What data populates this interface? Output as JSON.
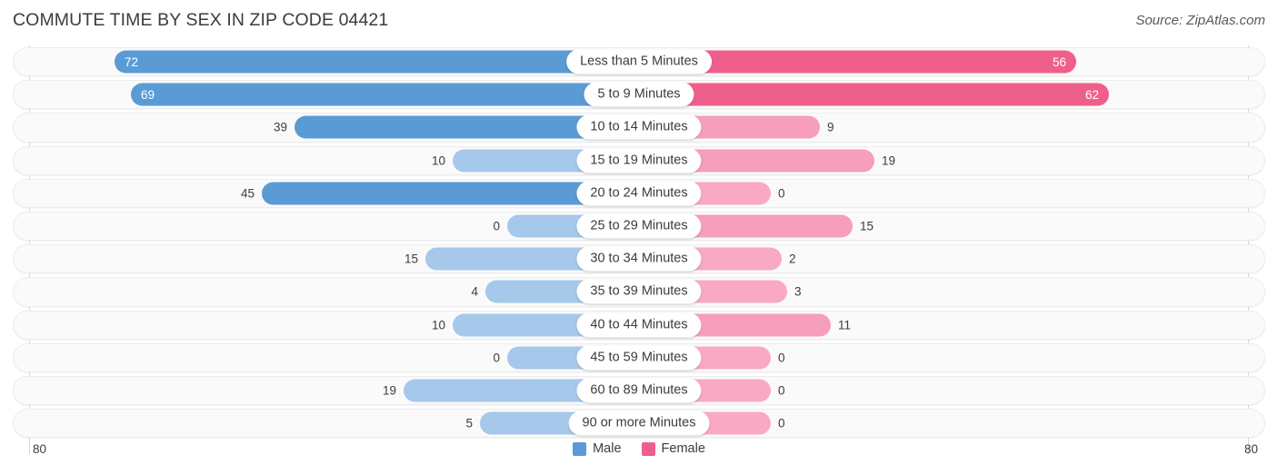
{
  "header": {
    "title": "COMMUTE TIME BY SEX IN ZIP CODE 04421",
    "source": "Source: ZipAtlas.com"
  },
  "footer": {
    "axis_left": "80",
    "axis_right": "80"
  },
  "legend": {
    "items": [
      {
        "label": "Male",
        "color": "#5b9bd5",
        "icon": "legend-swatch"
      },
      {
        "label": "Female",
        "color": "#ef5f8c",
        "icon": "legend-swatch"
      }
    ]
  },
  "chart_data": {
    "type": "bar",
    "subtype": "diverging-bidirectional",
    "title": "COMMUTE TIME BY SEX IN ZIP CODE 04421",
    "xlabel": "",
    "ylabel": "",
    "axis_max": 80,
    "axis_left_tick": "80",
    "axis_right_tick": "80",
    "grid": false,
    "legend_position": "bottom-center",
    "categories": [
      "Less than 5 Minutes",
      "5 to 9 Minutes",
      "10 to 14 Minutes",
      "15 to 19 Minutes",
      "20 to 24 Minutes",
      "25 to 29 Minutes",
      "30 to 34 Minutes",
      "35 to 39 Minutes",
      "40 to 44 Minutes",
      "45 to 59 Minutes",
      "60 to 89 Minutes",
      "90 or more Minutes"
    ],
    "series": [
      {
        "name": "Male",
        "color": "#5b9bd5",
        "direction": "left",
        "values": [
          72,
          69,
          39,
          10,
          45,
          0,
          15,
          4,
          10,
          0,
          19,
          5
        ]
      },
      {
        "name": "Female",
        "color": "#ef5f8c",
        "direction": "right",
        "values": [
          56,
          62,
          9,
          19,
          0,
          15,
          2,
          3,
          11,
          0,
          0,
          0
        ]
      }
    ]
  },
  "rows": [
    {
      "label": "Less than 5 Minutes",
      "male": "72",
      "female": "56",
      "male_inside": true,
      "female_inside": true
    },
    {
      "label": "5 to 9 Minutes",
      "male": "69",
      "female": "62",
      "male_inside": true,
      "female_inside": true
    },
    {
      "label": "10 to 14 Minutes",
      "male": "39",
      "female": "9",
      "male_inside": false,
      "female_inside": false
    },
    {
      "label": "15 to 19 Minutes",
      "male": "10",
      "female": "19",
      "male_inside": false,
      "female_inside": false
    },
    {
      "label": "20 to 24 Minutes",
      "male": "45",
      "female": "0",
      "male_inside": false,
      "female_inside": false
    },
    {
      "label": "25 to 29 Minutes",
      "male": "0",
      "female": "15",
      "male_inside": false,
      "female_inside": false
    },
    {
      "label": "30 to 34 Minutes",
      "male": "15",
      "female": "2",
      "male_inside": false,
      "female_inside": false
    },
    {
      "label": "35 to 39 Minutes",
      "male": "4",
      "female": "3",
      "male_inside": false,
      "female_inside": false
    },
    {
      "label": "40 to 44 Minutes",
      "male": "10",
      "female": "11",
      "male_inside": false,
      "female_inside": false
    },
    {
      "label": "45 to 59 Minutes",
      "male": "0",
      "female": "0",
      "male_inside": false,
      "female_inside": false
    },
    {
      "label": "60 to 89 Minutes",
      "male": "19",
      "female": "0",
      "male_inside": false,
      "female_inside": false
    },
    {
      "label": "90 or more Minutes",
      "male": "5",
      "female": "0",
      "male_inside": false,
      "female_inside": false
    }
  ]
}
